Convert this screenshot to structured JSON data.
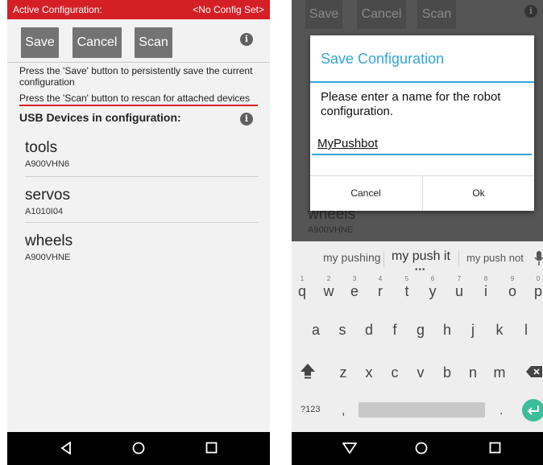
{
  "left_screen": {
    "status": {
      "title": "Active Configuration:",
      "config": "<No Config Set>"
    },
    "toolbar": {
      "save": "Save",
      "cancel": "Cancel",
      "scan": "Scan"
    },
    "messages": [
      "Press the 'Save' button to persistently save the current configuration",
      "Press the 'Scan' button to rescan for attached devices"
    ],
    "usb_heading": "USB Devices in configuration:",
    "devices": [
      {
        "name": "tools",
        "serial": "A900VHN6"
      },
      {
        "name": "servos",
        "serial": "A1010I04"
      },
      {
        "name": "wheels",
        "serial": "A900VHNE"
      }
    ]
  },
  "right_screen": {
    "background": {
      "save": "Save",
      "cancel": "Cancel",
      "scan": "Scan",
      "device_name": "wheels",
      "device_serial": "A900VHNE"
    },
    "dialog": {
      "title": "Save Configuration",
      "prompt": "Please enter a name for the robot configuration.",
      "input_value": "MyPushbot",
      "cancel": "Cancel",
      "ok": "Ok"
    },
    "keyboard": {
      "suggestions": [
        "my pushing",
        "my push it",
        "my push not"
      ],
      "row1": [
        "q",
        "w",
        "e",
        "r",
        "t",
        "y",
        "u",
        "i",
        "o",
        "p"
      ],
      "row1_hints": [
        "1",
        "2",
        "3",
        "4",
        "5",
        "6",
        "7",
        "8",
        "9",
        "0"
      ],
      "row2": [
        "a",
        "s",
        "d",
        "f",
        "g",
        "h",
        "j",
        "k",
        "l"
      ],
      "row3": [
        "z",
        "x",
        "c",
        "v",
        "b",
        "n",
        "m"
      ],
      "symbols_key": "?123",
      "comma": ",",
      "period": "."
    }
  },
  "colors": {
    "accent_red": "#d51f26",
    "dialog_blue": "#33a5d8",
    "enter_green": "#3dbd9a"
  }
}
